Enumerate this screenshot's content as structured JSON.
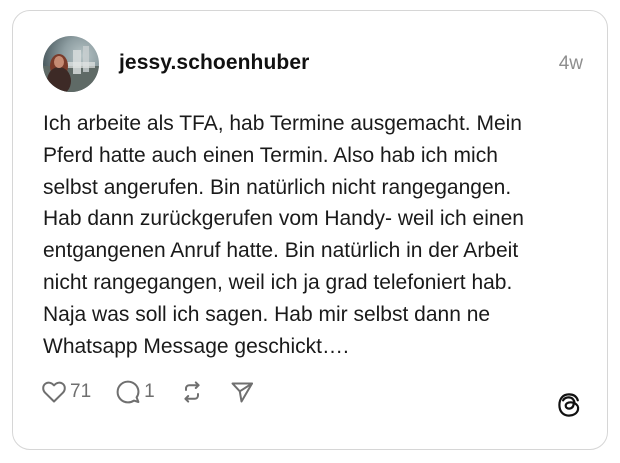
{
  "post": {
    "username": "jessy.schoenhuber",
    "timestamp": "4w",
    "text": "Ich arbeite als TFA, hab Termine ausgemacht. Mein\nPferd hatte auch einen Termin. Also hab ich mich\nselbst angerufen. Bin natürlich nicht rangegangen.\nHab dann zurückgerufen vom Handy- weil ich einen\nentgangenen Anruf hatte. Bin natürlich in der Arbeit\nnicht rangegangen, weil ich ja grad telefoniert hab.\nNaja was soll ich sagen. Hab mir selbst dann ne\nWhatsapp Message geschickt…."
  },
  "actions": {
    "like_count": "71",
    "reply_count": "1"
  },
  "icons": {
    "like": "heart-icon",
    "reply": "comment-bubble-icon",
    "repost": "repost-icon",
    "share": "send-icon",
    "brand": "threads-logo-icon"
  },
  "colors": {
    "border": "#d6d6d6",
    "text": "#1a1a1a",
    "muted": "#8e8e8e"
  }
}
